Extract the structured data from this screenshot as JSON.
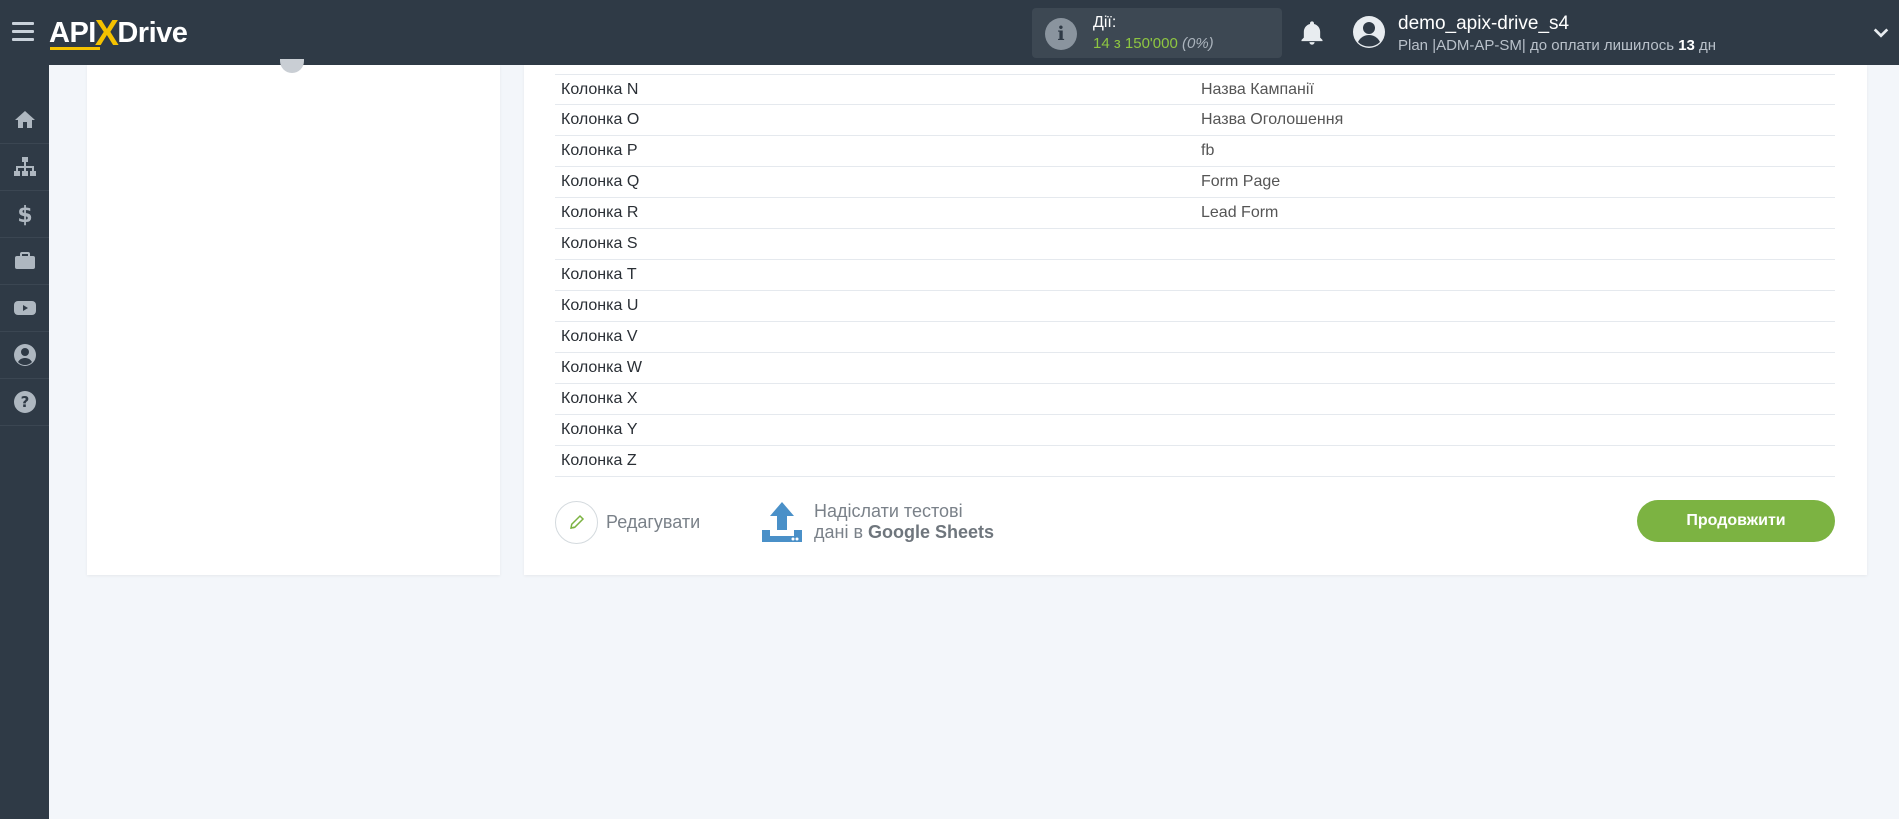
{
  "header": {
    "logo_left": "API",
    "logo_x": "X",
    "logo_right": "Drive",
    "actions_label": "Дії:",
    "actions_count": "14 з 150'000",
    "actions_percent": "(0%)",
    "username": "demo_apix-drive_s4",
    "plan_prefix": "Plan |ADM-AP-SM| до оплати лишилось ",
    "plan_days": "13",
    "plan_suffix": " дн"
  },
  "sidebar": {
    "items": [
      {
        "icon": "home-icon"
      },
      {
        "icon": "sitemap-icon"
      },
      {
        "icon": "dollar-icon"
      },
      {
        "icon": "briefcase-icon"
      },
      {
        "icon": "youtube-icon"
      },
      {
        "icon": "user-icon"
      },
      {
        "icon": "help-icon"
      }
    ]
  },
  "table": {
    "rows": [
      {
        "name": "Колонка N",
        "value": "Назва Кампанії"
      },
      {
        "name": "Колонка O",
        "value": "Назва Оголошення"
      },
      {
        "name": "Колонка P",
        "value": "fb"
      },
      {
        "name": "Колонка Q",
        "value": "Form Page"
      },
      {
        "name": "Колонка R",
        "value": "Lead Form"
      },
      {
        "name": "Колонка S",
        "value": ""
      },
      {
        "name": "Колонка T",
        "value": ""
      },
      {
        "name": "Колонка U",
        "value": ""
      },
      {
        "name": "Колонка V",
        "value": ""
      },
      {
        "name": "Колонка W",
        "value": ""
      },
      {
        "name": "Колонка X",
        "value": ""
      },
      {
        "name": "Колонка Y",
        "value": ""
      },
      {
        "name": "Колонка Z",
        "value": ""
      }
    ]
  },
  "footer": {
    "edit_label": "Редагувати",
    "send_line1": "Надіслати тестові",
    "send_line2_prefix": "дані в ",
    "send_line2_bold": "Google Sheets",
    "continue_label": "Продовжити"
  },
  "colors": {
    "topbar": "#2f3a46",
    "accent_green": "#7cb342",
    "logo_yellow": "#f5c200"
  }
}
